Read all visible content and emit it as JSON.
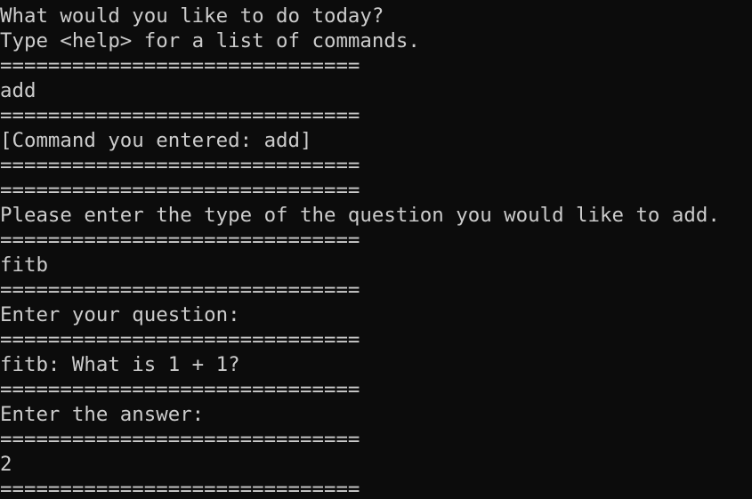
{
  "terminal": {
    "lines": [
      "What would you like to do today?",
      "Type <help> for a list of commands.",
      "==============================",
      "add",
      "==============================",
      "[Command you entered: add]",
      "==============================",
      "==============================",
      "Please enter the type of the question you would like to add.",
      "==============================",
      "fitb",
      "==============================",
      "Enter your question:",
      "==============================",
      "fitb: What is 1 + 1?",
      "==============================",
      "Enter the answer:",
      "==============================",
      "2",
      "=============================="
    ]
  },
  "colors": {
    "background": "#0c0c0c",
    "foreground": "#cccccc"
  }
}
